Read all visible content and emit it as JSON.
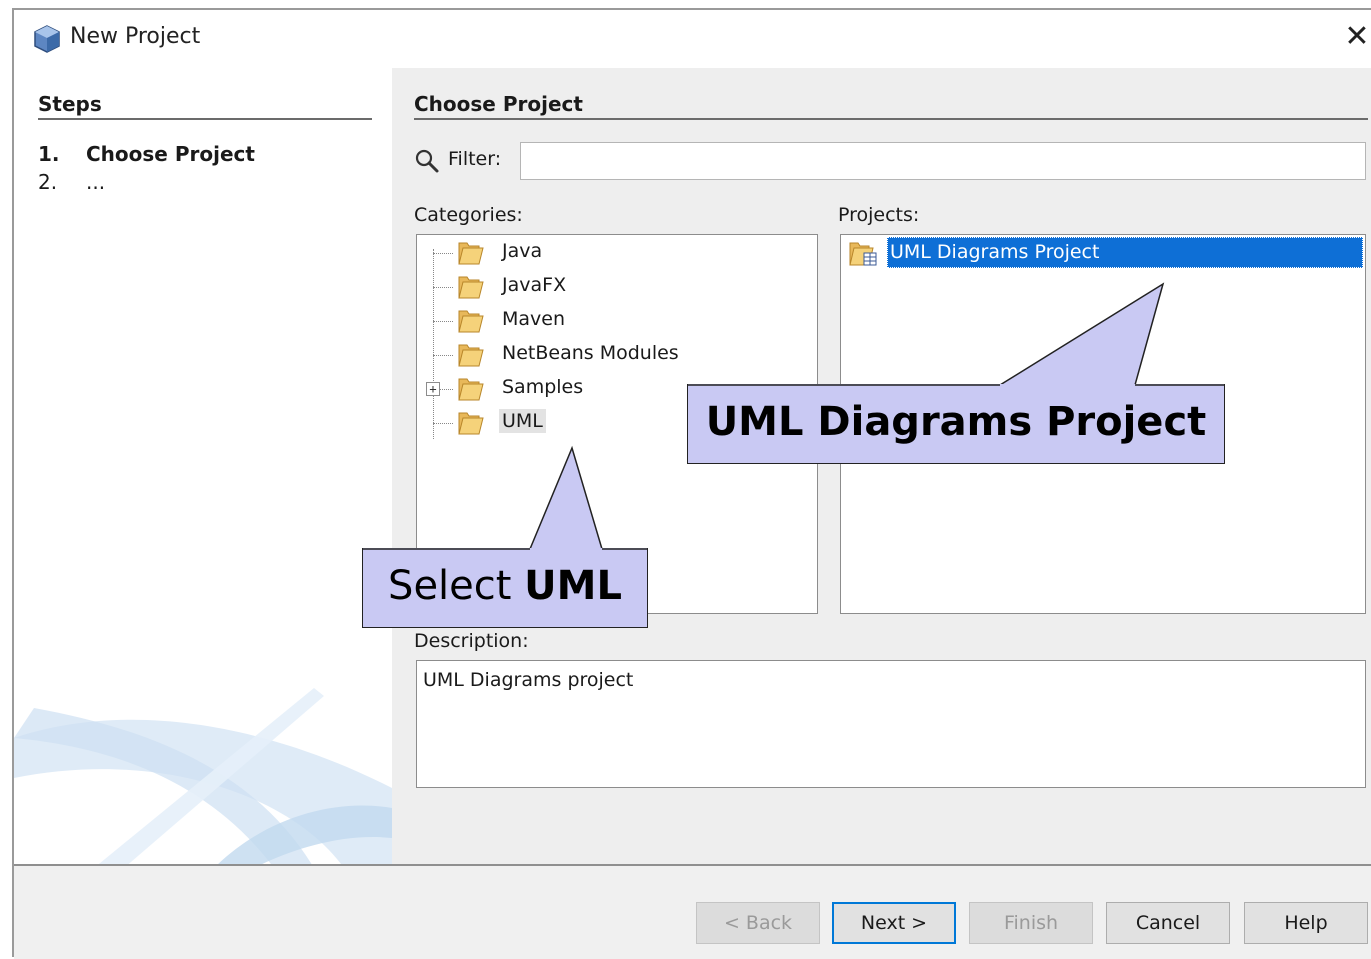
{
  "window": {
    "title": "New Project",
    "close_glyph": "✕"
  },
  "steps": {
    "heading": "Steps",
    "items": [
      {
        "number": "1.",
        "label": "Choose Project"
      },
      {
        "number": "2.",
        "label": "..."
      }
    ]
  },
  "content": {
    "heading": "Choose Project",
    "filter": {
      "label": "Filter:",
      "value": "",
      "placeholder": ""
    },
    "categories": {
      "label": "Categories:",
      "items": [
        {
          "label": "Java",
          "icon": "folder-icon"
        },
        {
          "label": "JavaFX",
          "icon": "folder-icon"
        },
        {
          "label": "Maven",
          "icon": "folder-icon"
        },
        {
          "label": "NetBeans Modules",
          "icon": "folder-icon"
        },
        {
          "label": "Samples",
          "icon": "folder-icon",
          "expandable": true,
          "expand_glyph": "+"
        },
        {
          "label": "UML",
          "icon": "folder-icon",
          "selected": true
        }
      ]
    },
    "projects": {
      "label": "Projects:",
      "items": [
        {
          "label": "UML Diagrams Project",
          "icon": "uml-project-icon",
          "selected": true
        }
      ]
    },
    "description": {
      "label": "Description:",
      "text": "UML Diagrams project"
    }
  },
  "buttons": {
    "back": "< Back",
    "next": "Next >",
    "finish": "Finish",
    "cancel": "Cancel",
    "help": "Help"
  },
  "callouts": {
    "select_uml_prefix": "Select ",
    "select_uml_bold": "UML",
    "project": "UML Diagrams Project"
  },
  "colors": {
    "selection": "#0e6fd6",
    "callout_fill": "#c9c9f3",
    "panel_bg": "#eeeeee",
    "default_button_border": "#0078d7"
  }
}
